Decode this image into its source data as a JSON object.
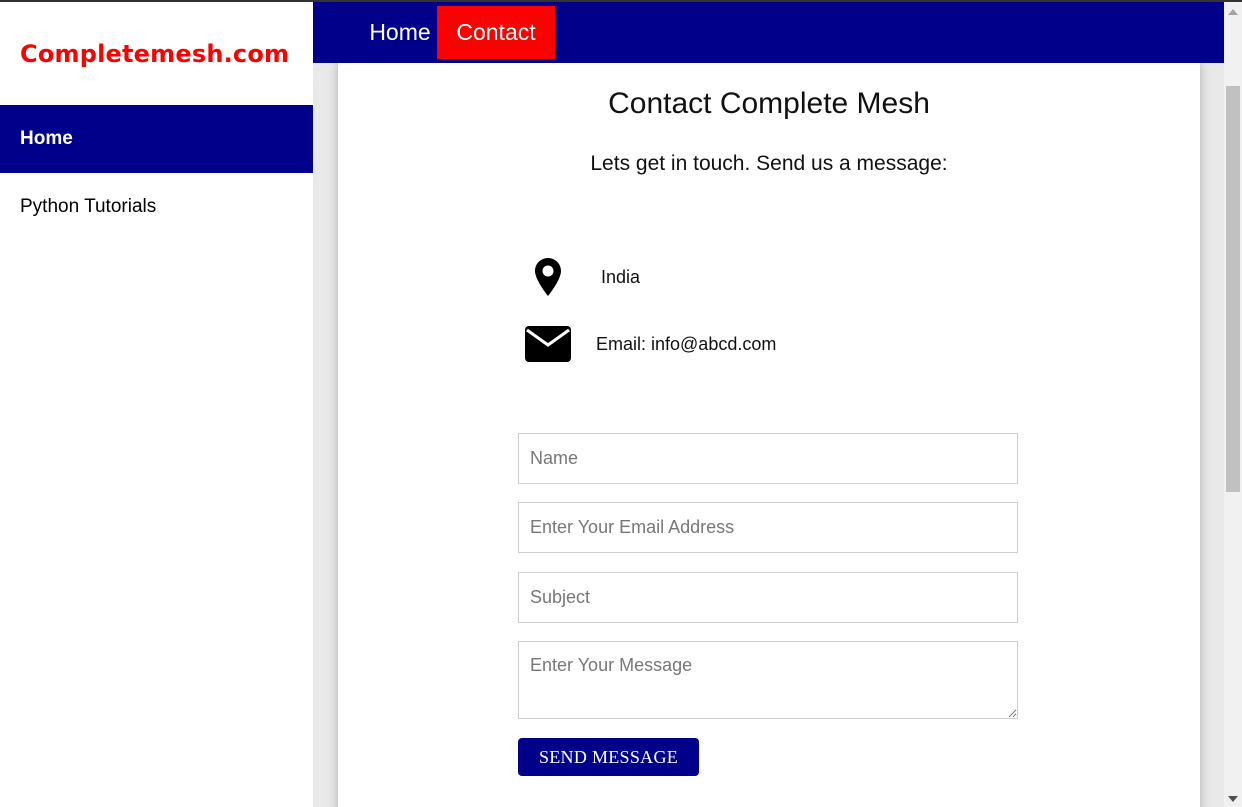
{
  "sidebar": {
    "brand": "Completemesh.com",
    "items": [
      {
        "label": "Home",
        "active": true
      },
      {
        "label": "Python Tutorials",
        "active": false
      }
    ]
  },
  "topnav": {
    "items": [
      {
        "label": "Home",
        "active": false
      },
      {
        "label": "Contact",
        "active": true
      }
    ]
  },
  "contact": {
    "title": "Contact Complete Mesh",
    "subtitle": "Lets get in touch. Send us a message:",
    "location": {
      "icon": "map-marker-icon",
      "text": "India"
    },
    "email": {
      "icon": "envelope-icon",
      "text": "Email: info@abcd.com"
    }
  },
  "form": {
    "name_placeholder": "Name",
    "email_placeholder": "Enter Your Email Address",
    "subject_placeholder": "Subject",
    "message_placeholder": "Enter Your Message",
    "send_label": "SEND MESSAGE"
  },
  "colors": {
    "brand": "#ff0000",
    "nav_bg": "#00008b",
    "active_tab": "#ff0000"
  }
}
